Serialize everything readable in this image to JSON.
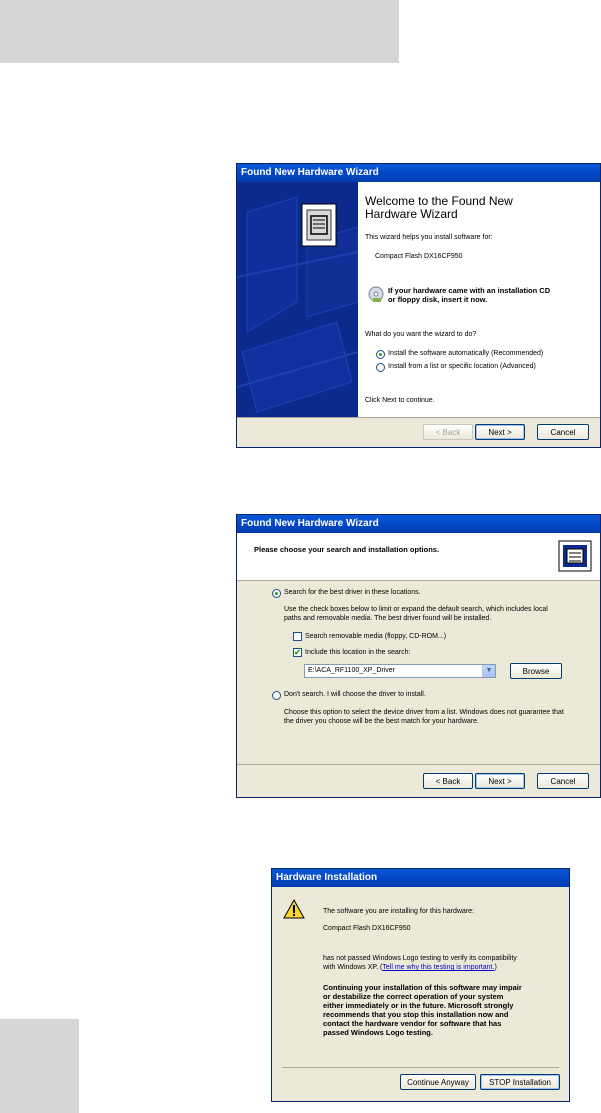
{
  "wizard1": {
    "title": "Found New Hardware Wizard",
    "heading_line1": "Welcome to the Found New",
    "heading_line2": "Hardware Wizard",
    "intro": "This wizard helps you install software for:",
    "device": "Compact Flash DX16CF950",
    "cd_line1": "If your hardware came with an installation CD",
    "cd_line2": "or floppy disk, insert it now.",
    "question": "What do you want the wizard to do?",
    "option_auto": "Install the software automatically (Recommended)",
    "option_list": "Install from a list or specific location (Advanced)",
    "continue_text": "Click Next to continue.",
    "back": "< Back",
    "next": "Next >",
    "cancel": "Cancel"
  },
  "wizard2": {
    "title": "Found New Hardware Wizard",
    "header": "Please choose your search and installation options.",
    "option_search": "Search for the best driver in these locations.",
    "search_desc_line1": "Use the check boxes below to limit or expand the default search, which includes local",
    "search_desc_line2": "paths and removable media. The best driver found will be installed.",
    "check_removable": "Search removable media (floppy, CD-ROM...)",
    "check_include": "Include this location in the search:",
    "path_value": "E:\\ACA_RF1100_XP_Driver",
    "browse": "Browse",
    "option_dont": "Don't search. I will choose the driver to install.",
    "dont_desc_line1": "Choose this option to select the device driver from a list. Windows does not guarantee that",
    "dont_desc_line2": "the driver you choose will be the best match for your hardware.",
    "back": "< Back",
    "next": "Next >",
    "cancel": "Cancel"
  },
  "hwinstall": {
    "title": "Hardware Installation",
    "line1": "The software you are installing for this hardware:",
    "device": "Compact Flash DX16CF950",
    "logo_line1": "has not passed Windows Logo testing to verify its compatibility",
    "logo_line2_prefix": "with Windows XP. (",
    "logo_link": "Tell me why this testing is important.",
    "logo_line2_suffix": ")",
    "warn1": "Continuing your installation of this software may impair",
    "warn2": "or destabilize the correct operation of your system",
    "warn3": "either immediately or in the future. Microsoft strongly",
    "warn4": "recommends that you stop this installation now and",
    "warn5": "contact the hardware vendor for software that has",
    "warn6": "passed Windows Logo testing.",
    "continue": "Continue Anyway",
    "stop": "STOP Installation"
  }
}
